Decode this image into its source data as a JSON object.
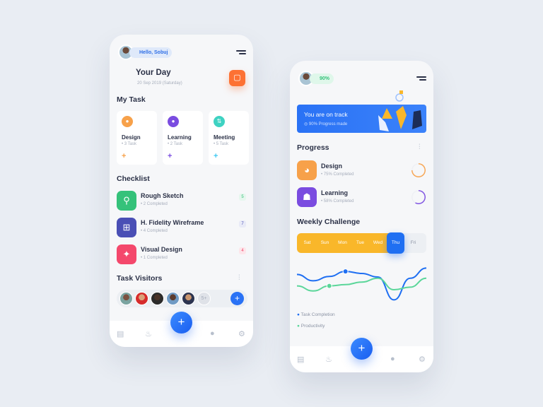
{
  "left": {
    "greeting": "Hello, Sobuj",
    "title": "Your Day",
    "date": "20 Sep 2019 (Saturday)",
    "my_task_heading": "My Task",
    "tasks": [
      {
        "name": "Design",
        "count": "• 3 Task",
        "icon": "palette-icon",
        "color": "#f7a14a"
      },
      {
        "name": "Learning",
        "count": "• 2 Task",
        "icon": "learner-icon",
        "color": "#7a4ce0"
      },
      {
        "name": "Meeting",
        "count": "• 5 Task",
        "icon": "swap-icon",
        "color": "#3ed2c2"
      }
    ],
    "checklist_heading": "Checklist",
    "checklist": [
      {
        "name": "Rough Sketch",
        "sub": "• 2 Completed",
        "badge": "5",
        "color": "#35c27a"
      },
      {
        "name": "H. Fidelity Wireframe",
        "sub": "• 4 Completed",
        "badge": "7",
        "color": "#4a4fb5"
      },
      {
        "name": "Visual Design",
        "sub": "• 1 Completed",
        "badge": "4",
        "color": "#f4486c"
      }
    ],
    "visitors_heading": "Task Visitors",
    "visitors_more": "5+",
    "add": "+"
  },
  "right": {
    "progress_pill": "90%",
    "banner_title": "You are on track",
    "banner_sub": "90% Progress made",
    "progress_heading": "Progress",
    "progress": [
      {
        "name": "Design",
        "sub": "• 75% Completed",
        "value": 0.75,
        "color": "#f7a14a"
      },
      {
        "name": "Learning",
        "sub": "• 58% Completed",
        "value": 0.58,
        "color": "#7a4ce0"
      }
    ],
    "weekly_heading": "Weekly Challenge",
    "days": [
      "Sat",
      "Sun",
      "Mon",
      "Tue",
      "Wed",
      "Thu",
      "Fri"
    ],
    "active_day": "Thu",
    "legend": [
      "Task Completion",
      "Productivity"
    ],
    "add": "+"
  },
  "chart_data": {
    "type": "line",
    "series": [
      {
        "name": "Task Completion",
        "color": "#1f6ff2",
        "values": [
          0.7,
          0.45,
          0.62,
          0.82,
          0.74,
          0.6,
          -0.3,
          0.55,
          0.95
        ]
      },
      {
        "name": "Productivity",
        "color": "#5bd69a",
        "values": [
          0.25,
          0.05,
          0.25,
          0.3,
          0.4,
          0.55,
          0.1,
          0.2,
          0.55
        ]
      }
    ]
  }
}
